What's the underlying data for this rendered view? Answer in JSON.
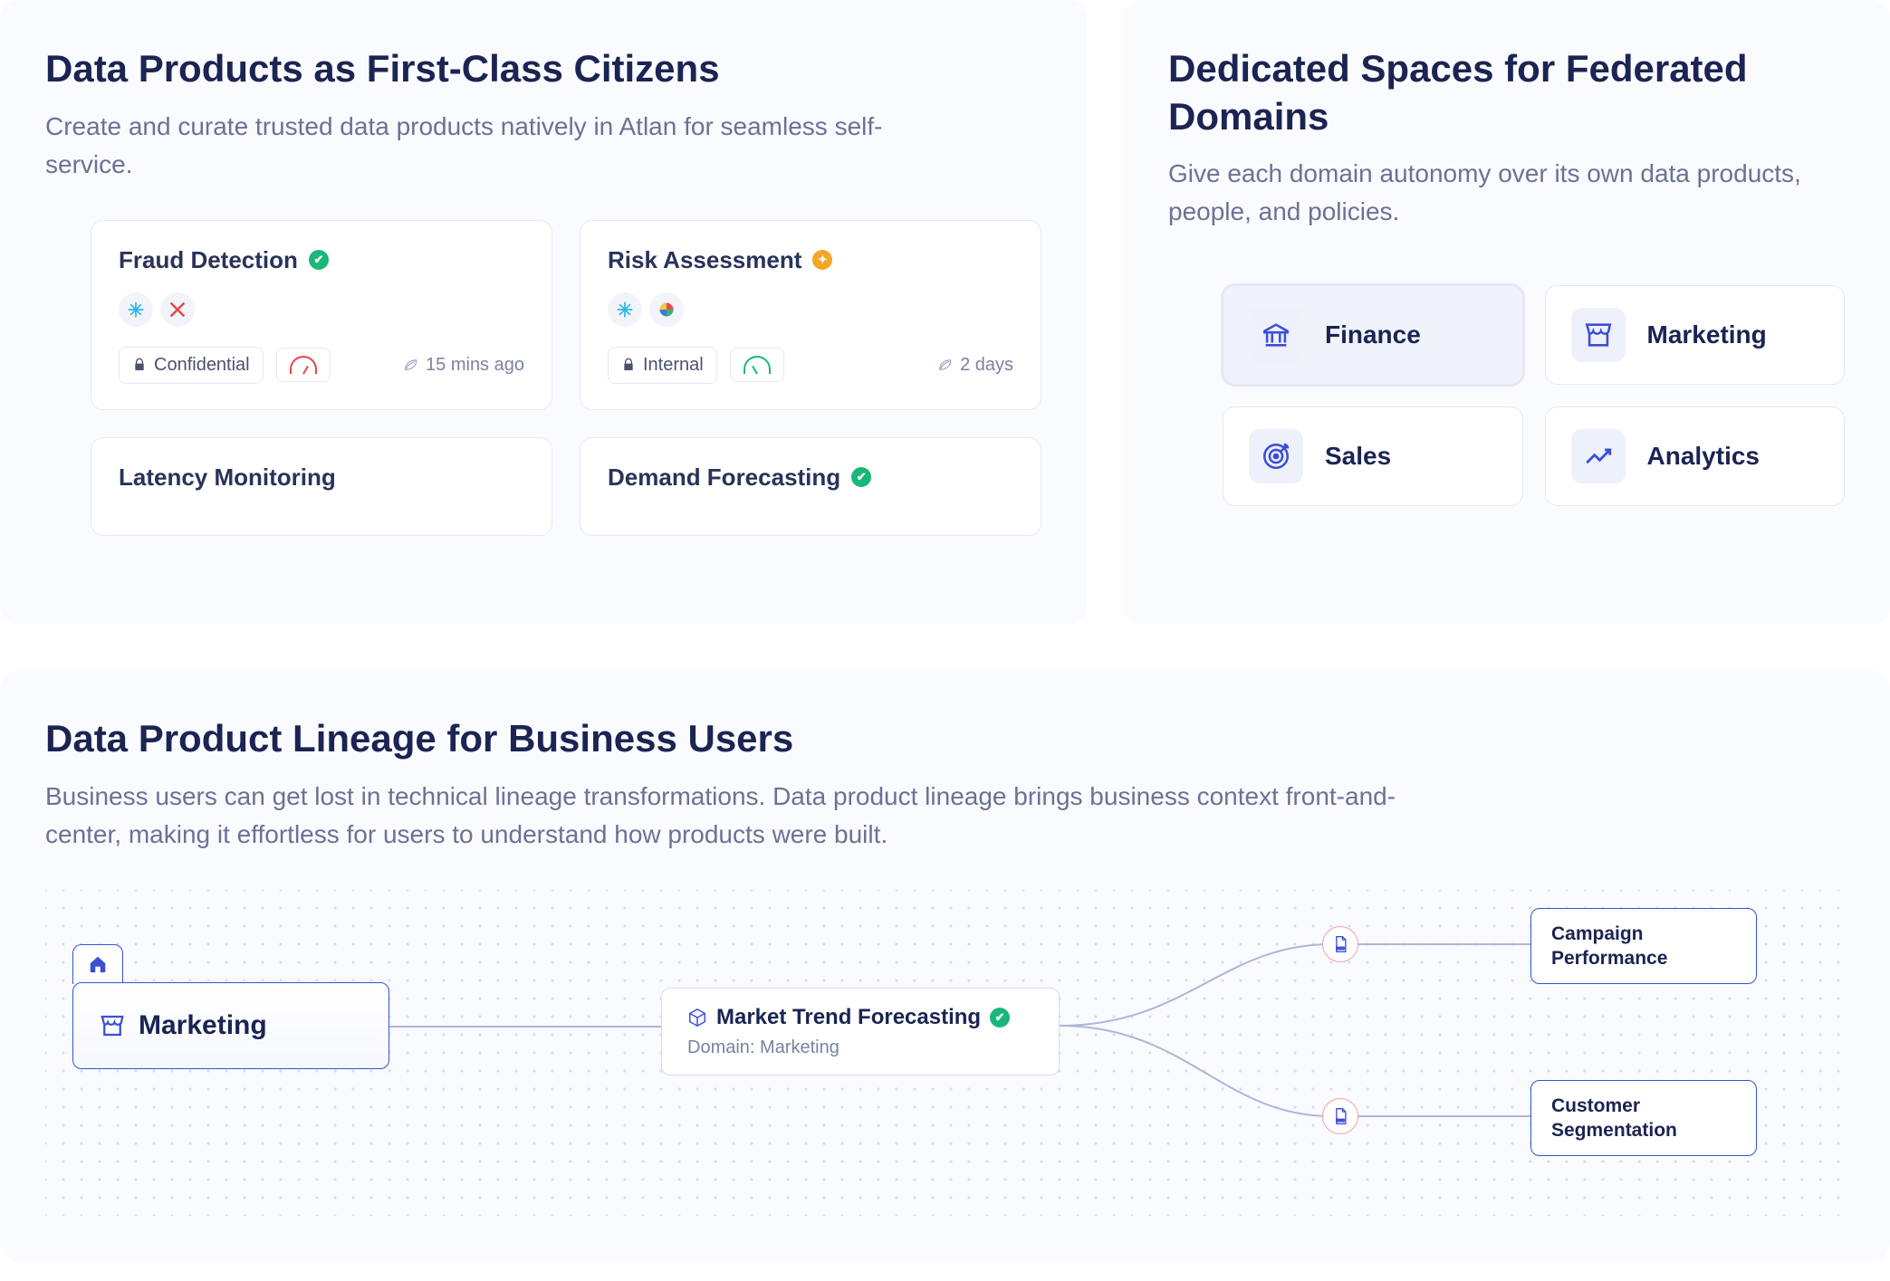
{
  "panels": {
    "products": {
      "title": "Data Products as First-Class Citizens",
      "subtitle": "Create and curate trusted data products natively in Atlan for seamless self-service.",
      "cards": [
        {
          "title": "Fraud Detection",
          "badge": "green",
          "icons": [
            "snowflake",
            "x-processor"
          ],
          "tag_icon": "lock",
          "tag": "Confidential",
          "gauge": "red",
          "time_icon": "leaf",
          "time": "15 mins ago"
        },
        {
          "title": "Risk Assessment",
          "badge": "orange",
          "icons": [
            "snowflake",
            "pinwheel"
          ],
          "tag_icon": "lock",
          "tag": "Internal",
          "gauge": "green",
          "time_icon": "leaf",
          "time": "2 days"
        },
        {
          "title": "Latency Monitoring",
          "badge": null
        },
        {
          "title": "Demand Forecasting",
          "badge": "green"
        }
      ]
    },
    "domains": {
      "title": "Dedicated Spaces for Federated Domains",
      "subtitle": "Give each domain autonomy over its own data products, people, and policies.",
      "items": [
        {
          "icon": "bank",
          "label": "Finance",
          "active": true
        },
        {
          "icon": "storefront",
          "label": "Marketing",
          "active": false
        },
        {
          "icon": "target",
          "label": "Sales",
          "active": false
        },
        {
          "icon": "trend",
          "label": "Analytics",
          "active": false
        }
      ]
    },
    "lineage": {
      "title": "Data Product Lineage for Business Users",
      "subtitle": "Business users can get lost in technical lineage transformations. Data product lineage brings business context front-and-center, making it effortless for users to understand how products were built.",
      "root": {
        "icon": "home",
        "domain_icon": "storefront",
        "label": "Marketing"
      },
      "mid": {
        "icon": "cube",
        "label": "Market Trend Forecasting",
        "badge": "green",
        "sub": "Domain: Marketing"
      },
      "leaves": [
        {
          "icon": "doc",
          "label": "Campaign Performance"
        },
        {
          "icon": "doc",
          "label": "Customer Segmentation"
        }
      ]
    }
  }
}
